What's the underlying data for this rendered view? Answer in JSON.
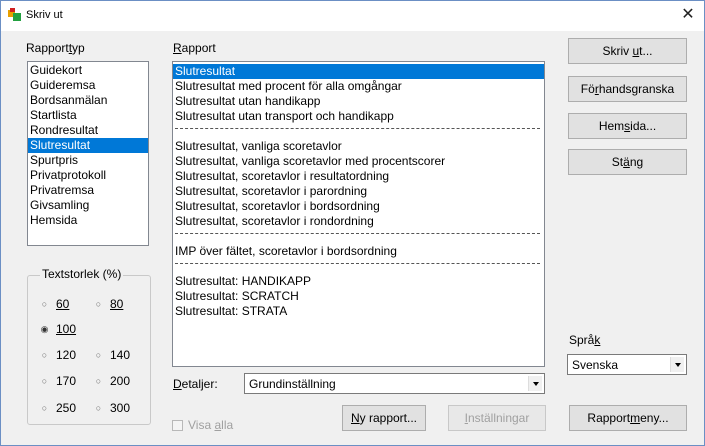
{
  "window": {
    "title": "Skriv ut",
    "close": "✕"
  },
  "rapporttyp": {
    "label": "Rapporttyp",
    "items": [
      "Guidekort",
      "Guideremsa",
      "Bordsanmälan",
      "Startlista",
      "Rondresultat",
      "Slutresultat",
      "Spurtpris",
      "Privatprotokoll",
      "Privatremsa",
      "Givsamling",
      "Hemsida"
    ],
    "selected": "Slutresultat"
  },
  "textstorlek": {
    "title": "Textstorlek (%)",
    "options": [
      "60",
      "80",
      "100",
      "120",
      "140",
      "170",
      "200",
      "250",
      "300"
    ],
    "selected": "100"
  },
  "rapport": {
    "label": "Rapport",
    "group1": [
      "Slutresultat",
      "Slutresultat med procent för alla omgångar",
      "Slutresultat utan handikapp",
      "Slutresultat utan transport och handikapp"
    ],
    "group2": [
      "Slutresultat, vanliga scoretavlor",
      "Slutresultat, vanliga scoretavlor med procentscorer",
      "Slutresultat, scoretavlor i resultatordning",
      "Slutresultat, scoretavlor i parordning",
      "Slutresultat, scoretavlor i bordsordning",
      "Slutresultat, scoretavlor i rondordning"
    ],
    "group3": [
      "IMP över fältet, scoretavlor i bordsordning"
    ],
    "group4": [
      "Slutresultat: HANDIKAPP",
      "Slutresultat: SCRATCH",
      "Slutresultat: STRATA"
    ],
    "selected": "Slutresultat"
  },
  "detaljer": {
    "label": "Detaljer:",
    "value": "Grundinställning"
  },
  "visa_alla": {
    "label": "Visa alla",
    "checked": false
  },
  "buttons": {
    "skriv_ut": "Skriv ut...",
    "forhandsgranska": "Förhandsgranska",
    "hemsida": "Hemsida...",
    "stang": "Stäng",
    "ny_rapport": "Ny rapport...",
    "installningar": "Inställningar",
    "rapportmeny": "Rapportmeny..."
  },
  "sprak": {
    "label": "Språk",
    "value": "Svenska"
  },
  "colors": {
    "selection": "#0078d7",
    "dialog_bg": "#f0f0f0"
  }
}
